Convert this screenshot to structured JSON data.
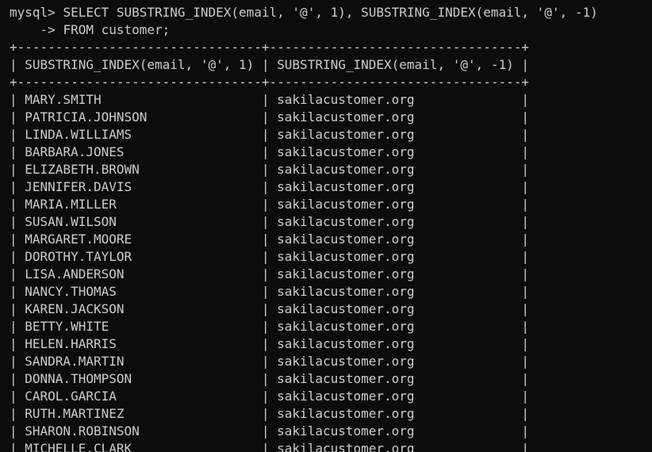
{
  "terminal": {
    "prompt": "mysql> ",
    "query_line1": "SELECT SUBSTRING_INDEX(email, '@', 1), SUBSTRING_INDEX(email, '@', -1)",
    "continuation_prompt": "    -> ",
    "query_line2": "FROM customer;",
    "columns": [
      "SUBSTRING_INDEX(email, '@', 1)",
      "SUBSTRING_INDEX(email, '@', -1)"
    ],
    "rows": [
      [
        "MARY.SMITH",
        "sakilacustomer.org"
      ],
      [
        "PATRICIA.JOHNSON",
        "sakilacustomer.org"
      ],
      [
        "LINDA.WILLIAMS",
        "sakilacustomer.org"
      ],
      [
        "BARBARA.JONES",
        "sakilacustomer.org"
      ],
      [
        "ELIZABETH.BROWN",
        "sakilacustomer.org"
      ],
      [
        "JENNIFER.DAVIS",
        "sakilacustomer.org"
      ],
      [
        "MARIA.MILLER",
        "sakilacustomer.org"
      ],
      [
        "SUSAN.WILSON",
        "sakilacustomer.org"
      ],
      [
        "MARGARET.MOORE",
        "sakilacustomer.org"
      ],
      [
        "DOROTHY.TAYLOR",
        "sakilacustomer.org"
      ],
      [
        "LISA.ANDERSON",
        "sakilacustomer.org"
      ],
      [
        "NANCY.THOMAS",
        "sakilacustomer.org"
      ],
      [
        "KAREN.JACKSON",
        "sakilacustomer.org"
      ],
      [
        "BETTY.WHITE",
        "sakilacustomer.org"
      ],
      [
        "HELEN.HARRIS",
        "sakilacustomer.org"
      ],
      [
        "SANDRA.MARTIN",
        "sakilacustomer.org"
      ],
      [
        "DONNA.THOMPSON",
        "sakilacustomer.org"
      ],
      [
        "CAROL.GARCIA",
        "sakilacustomer.org"
      ],
      [
        "RUTH.MARTINEZ",
        "sakilacustomer.org"
      ],
      [
        "SHARON.ROBINSON",
        "sakilacustomer.org"
      ],
      [
        "MICHELLE.CLARK",
        "sakilacustomer.org"
      ]
    ]
  }
}
